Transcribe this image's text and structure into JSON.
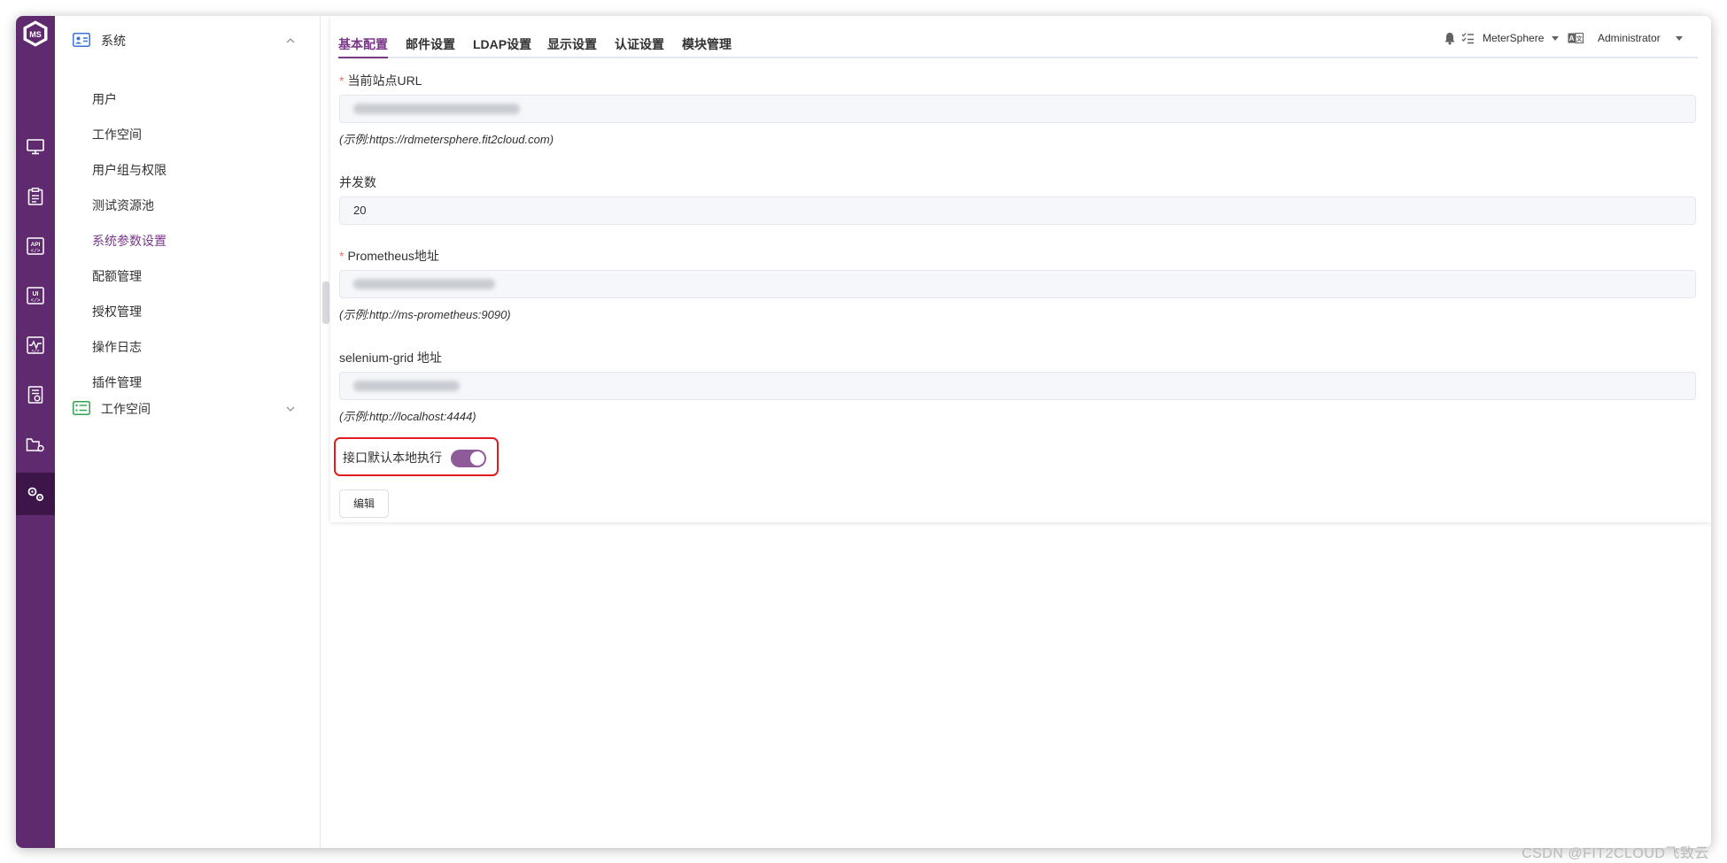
{
  "sidebar": {
    "system_group": {
      "label": "系统",
      "expanded": true
    },
    "items": [
      {
        "label": "用户"
      },
      {
        "label": "工作空间"
      },
      {
        "label": "用户组与权限"
      },
      {
        "label": "测试资源池"
      },
      {
        "label": "系统参数设置",
        "active": true
      },
      {
        "label": "配额管理"
      },
      {
        "label": "授权管理"
      },
      {
        "label": "操作日志"
      },
      {
        "label": "插件管理"
      }
    ],
    "workspace_group": {
      "label": "工作空间",
      "expanded": false
    }
  },
  "rail": {
    "icons": [
      "workbench-icon",
      "test-track-icon",
      "api-icon",
      "ui-test-icon",
      "performance-icon",
      "report-icon",
      "project-icon",
      "settings-icon"
    ],
    "active": "settings-icon"
  },
  "tabs": [
    {
      "label": "基本配置",
      "active": true
    },
    {
      "label": "邮件设置"
    },
    {
      "label": "LDAP设置"
    },
    {
      "label": "显示设置"
    },
    {
      "label": "认证设置"
    },
    {
      "label": "模块管理"
    }
  ],
  "header": {
    "project": "MeterSphere",
    "user": "Administrator"
  },
  "form": {
    "url_label": "当前站点URL",
    "url_hint": "(示例:https://rdmetersphere.fit2cloud.com)",
    "concurrency_label": "并发数",
    "concurrency_value": "20",
    "prometheus_label": "Prometheus地址",
    "prometheus_hint": "(示例:http://ms-prometheus:9090)",
    "selenium_label": "selenium-grid 地址",
    "selenium_hint": "(示例:http://localhost:4444)",
    "local_exec_label": "接口默认本地执行",
    "local_exec_enabled": true,
    "edit_button": "编辑"
  },
  "colors": {
    "brand": "#783887",
    "rail": "#5f2a6e",
    "highlight_border": "#e01c1c"
  },
  "watermark": "CSDN @FIT2CLOUD飞致云"
}
